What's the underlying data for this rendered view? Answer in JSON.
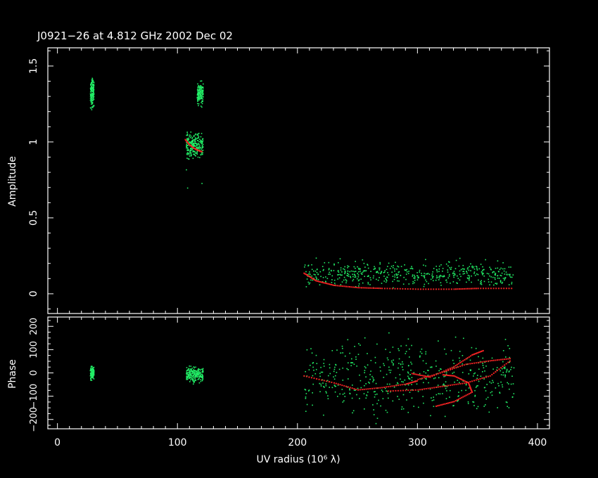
{
  "colors": {
    "background": "#000000",
    "axes": "#ffffff",
    "data": "#22ee66",
    "model": "#ee2222"
  },
  "chart_data": [
    {
      "type": "scatter",
      "panel": "amplitude",
      "title": "J0921−26 at 4.812 GHz 2002 Dec 02",
      "ylabel": "Amplitude",
      "xlim": [
        -8,
        410
      ],
      "ylim": [
        -0.13,
        1.62
      ],
      "yticks": [
        0,
        0.5,
        1,
        1.5
      ],
      "ytick_labels": [
        "0",
        "0.5",
        "1",
        "1.5"
      ],
      "grid": false,
      "series": [
        {
          "role": "data",
          "groups": [
            {
              "x": [
                27,
                30
              ],
              "y": [
                1.2,
                1.46
              ],
              "count": 160
            },
            {
              "x": [
                116,
                121
              ],
              "y": [
                1.22,
                1.42
              ],
              "count": 140
            },
            {
              "x": [
                107,
                121
              ],
              "y": [
                0.86,
                1.1
              ],
              "count": 230
            },
            {
              "x": [
                205,
                380
              ],
              "y": [
                0.02,
                0.25
              ],
              "count": 500
            }
          ],
          "outliers": [
            [
              107,
              0.82
            ],
            [
              108,
              0.7
            ],
            [
              120,
              0.73
            ]
          ]
        },
        {
          "role": "model",
          "clusters": [
            {
              "x": [
                106,
                109,
                112,
                115,
                118,
                120
              ],
              "y": [
                1.02,
                0.99,
                0.97,
                0.955,
                0.945,
                0.94
              ]
            }
          ],
          "line": {
            "x": [
              205,
              215,
              230,
              250,
              270,
              300,
              330,
              350,
              380
            ],
            "y": [
              0.14,
              0.09,
              0.06,
              0.045,
              0.04,
              0.035,
              0.035,
              0.04,
              0.04
            ]
          }
        }
      ]
    },
    {
      "type": "scatter",
      "panel": "phase",
      "xlabel": "UV radius  (10⁶ λ)",
      "ylabel": "Phase",
      "xlim": [
        -8,
        410
      ],
      "ylim": [
        -240,
        240
      ],
      "xticks": [
        0,
        100,
        200,
        300,
        400
      ],
      "xtick_labels": [
        "0",
        "100",
        "200",
        "300",
        "400"
      ],
      "yticks": [
        -200,
        -100,
        0,
        100,
        200
      ],
      "ytick_labels": [
        "−200",
        "−100",
        "0",
        "100",
        "200"
      ],
      "grid": false,
      "series": [
        {
          "role": "data",
          "groups": [
            {
              "x": [
                27,
                30
              ],
              "y": [
                -40,
                40
              ],
              "count": 120
            },
            {
              "x": [
                107,
                121
              ],
              "y": [
                -50,
                40
              ],
              "count": 220
            },
            {
              "x": [
                205,
                380
              ],
              "y": [
                -230,
                200
              ],
              "count": 500
            }
          ]
        },
        {
          "role": "model",
          "curves": [
            {
              "x": [
                205,
                230,
                250,
                270,
                290,
                300
              ],
              "y": [
                -10,
                -40,
                -70,
                -60,
                -45,
                -30
              ]
            },
            {
              "x": [
                275,
                300,
                320,
                340,
                360,
                378
              ],
              "y": [
                -75,
                -70,
                -55,
                -40,
                -10,
                60
              ]
            },
            {
              "x": [
                295,
                310,
                330,
                345,
                355
              ],
              "y": [
                0,
                -15,
                30,
                80,
                100
              ]
            },
            {
              "x": [
                315,
                330,
                345,
                342,
                330,
                320
              ],
              "y": [
                -140,
                -120,
                -80,
                -40,
                -10,
                -5
              ]
            },
            {
              "x": [
                300,
                320,
                340,
                360,
                378
              ],
              "y": [
                -25,
                5,
                40,
                55,
                65
              ]
            }
          ]
        }
      ]
    }
  ]
}
